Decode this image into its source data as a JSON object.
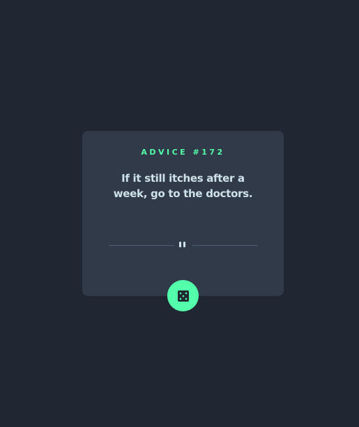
{
  "advice": {
    "id_label": "ADVICE #172",
    "text": "If it still itches after a week, go to the doctors."
  },
  "icons": {
    "divider": "pause-icon",
    "button": "dice-icon"
  },
  "colors": {
    "background": "#202733",
    "card": "#313A48",
    "accent": "#53FFAA",
    "text": "#CEE3E9",
    "divider": "#4F5D74"
  }
}
